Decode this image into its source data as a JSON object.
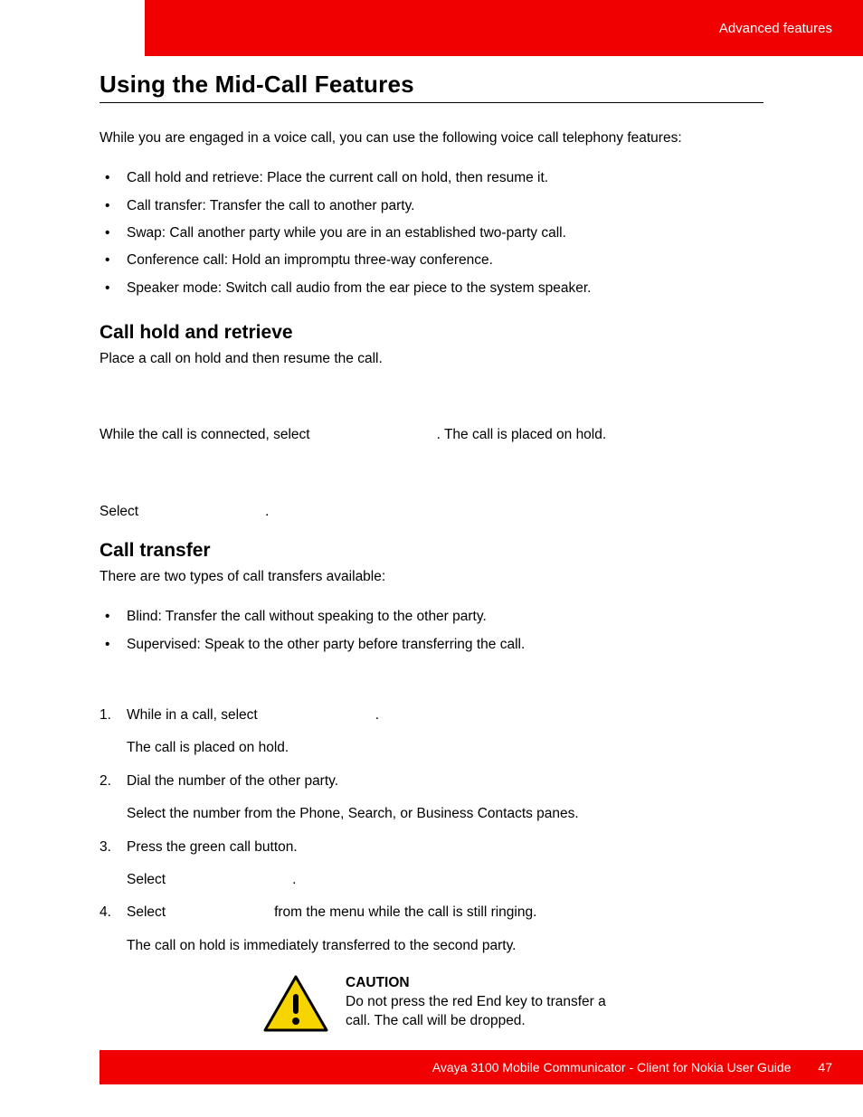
{
  "header": {
    "section": "Advanced features"
  },
  "title": "Using the Mid-Call Features",
  "intro": "While you are engaged in a voice call, you can use the following voice call telephony features:",
  "features": [
    "Call hold and retrieve: Place the current call on hold, then resume it.",
    "Call transfer: Transfer the call to another party.",
    "Swap: Call another party while you are in an established two-party call.",
    "Conference call: Hold an impromptu three-way conference.",
    "Speaker mode: Switch call audio from the ear piece to the system speaker."
  ],
  "hold": {
    "heading": "Call hold and retrieve",
    "p1": "Place a call on hold and then resume the call.",
    "line1a": "While the call is connected, select",
    "line1b": ". The call is placed on hold.",
    "line2a": "Select",
    "line2b": "."
  },
  "transfer": {
    "heading": "Call transfer",
    "p1": "There are two types of call transfers available:",
    "types": [
      "Blind: Transfer the call without speaking to the other party.",
      "Supervised: Speak to the other party before transferring the call."
    ],
    "steps": {
      "s1a": "While in a call, select",
      "s1b": ".",
      "s1c": "The call is placed on hold.",
      "s2": "Dial the number of the other party.",
      "s2b": "Select the number from the Phone, Search, or Business Contacts panes.",
      "s3": "Press the green call button.",
      "s3b_a": "Select",
      "s3b_b": ".",
      "s4a": "Select",
      "s4b": "from the menu while the call is still ringing.",
      "s4c": "The call on hold is immediately transferred to the second party."
    }
  },
  "caution": {
    "label": "CAUTION",
    "text": "Do not press the red End key to transfer a call. The call will be dropped."
  },
  "footer": {
    "doc": "Avaya 3100 Mobile Communicator - Client for Nokia User Guide",
    "page": "47"
  }
}
